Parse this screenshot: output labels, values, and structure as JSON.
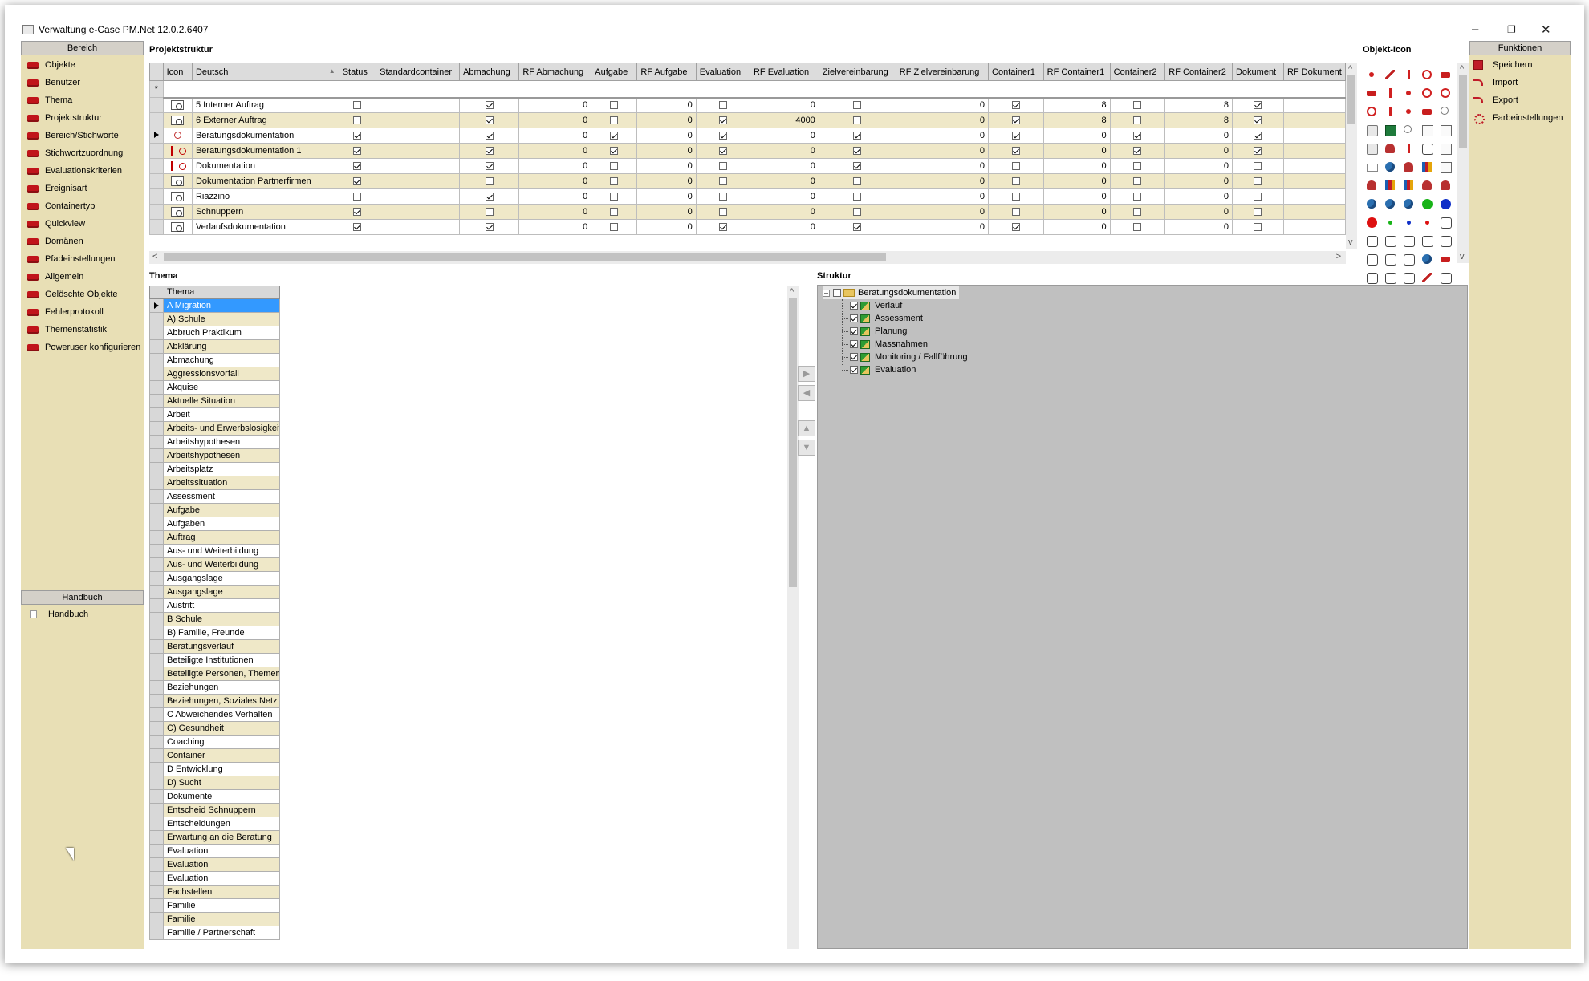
{
  "window": {
    "title": "Verwaltung e-Case PM.Net 12.0.2.6407",
    "minimize": "–",
    "restore": "❐",
    "close": "✕"
  },
  "bereich": {
    "header": "Bereich",
    "items": [
      "Objekte",
      "Benutzer",
      "Thema",
      "Projektstruktur",
      "Bereich/Stichworte",
      "Stichwortzuordnung",
      "Evaluationskriterien",
      "Ereignisart",
      "Containertyp",
      "Quickview",
      "Domänen",
      "Pfadeinstellungen",
      "Allgemein",
      "Gelöschte Objekte",
      "Fehlerprotokoll",
      "Themenstatistik",
      "Poweruser konfigurieren"
    ]
  },
  "handbuch": {
    "header": "Handbuch",
    "items": [
      "Handbuch"
    ]
  },
  "projektstruktur": {
    "title": "Projektstruktur",
    "new_row_marker": "*",
    "columns": [
      "Icon",
      "Deutsch",
      "Status",
      "Standardcontainer",
      "Abmachung",
      "RF Abmachung",
      "Aufgabe",
      "RF Aufgabe",
      "Evaluation",
      "RF Evaluation",
      "Zielvereinbarung",
      "RF Zielvereinbarung",
      "Container1",
      "RF Container1",
      "Container2",
      "RF Container2",
      "Dokument",
      "RF Dokument"
    ],
    "rows": [
      {
        "icon": "document-icon",
        "name": "5 Interner Auftrag",
        "status": false,
        "abm": true,
        "rf_abm": "0",
        "auf": false,
        "rf_auf": "0",
        "eval": false,
        "rf_eval": "0",
        "ziel": false,
        "rf_ziel": "0",
        "c1": true,
        "rf_c1": "8",
        "c2": false,
        "rf_c2": "8",
        "dok": true
      },
      {
        "icon": "document-icon",
        "name": "6 Externer Auftrag",
        "status": false,
        "abm": true,
        "rf_abm": "0",
        "auf": false,
        "rf_auf": "0",
        "eval": true,
        "rf_eval": "4000",
        "ziel": false,
        "rf_ziel": "0",
        "c1": true,
        "rf_c1": "8",
        "c2": false,
        "rf_c2": "8",
        "dok": true
      },
      {
        "icon": "magnifier-icon",
        "name": "Beratungsdokumentation",
        "status": true,
        "abm": true,
        "rf_abm": "0",
        "auf": true,
        "rf_auf": "0",
        "eval": true,
        "rf_eval": "0",
        "ziel": true,
        "rf_ziel": "0",
        "c1": true,
        "rf_c1": "0",
        "c2": true,
        "rf_c2": "0",
        "dok": true
      },
      {
        "icon": "red-ring-icon",
        "name": "Beratungsdokumentation 1",
        "status": true,
        "abm": true,
        "rf_abm": "0",
        "auf": true,
        "rf_auf": "0",
        "eval": true,
        "rf_eval": "0",
        "ziel": true,
        "rf_ziel": "0",
        "c1": true,
        "rf_c1": "0",
        "c2": true,
        "rf_c2": "0",
        "dok": true
      },
      {
        "icon": "red-ring-icon",
        "name": "Dokumentation",
        "status": true,
        "abm": true,
        "rf_abm": "0",
        "auf": false,
        "rf_auf": "0",
        "eval": false,
        "rf_eval": "0",
        "ziel": true,
        "rf_ziel": "0",
        "c1": false,
        "rf_c1": "0",
        "c2": false,
        "rf_c2": "0",
        "dok": false
      },
      {
        "icon": "document-icon",
        "name": "Dokumentation Partnerfirmen",
        "status": true,
        "abm": false,
        "rf_abm": "0",
        "auf": false,
        "rf_auf": "0",
        "eval": false,
        "rf_eval": "0",
        "ziel": false,
        "rf_ziel": "0",
        "c1": false,
        "rf_c1": "0",
        "c2": false,
        "rf_c2": "0",
        "dok": false
      },
      {
        "icon": "document-icon",
        "name": "Riazzino",
        "status": false,
        "abm": true,
        "rf_abm": "0",
        "auf": false,
        "rf_auf": "0",
        "eval": false,
        "rf_eval": "0",
        "ziel": false,
        "rf_ziel": "0",
        "c1": false,
        "rf_c1": "0",
        "c2": false,
        "rf_c2": "0",
        "dok": false
      },
      {
        "icon": "document-icon",
        "name": "Schnuppern",
        "status": true,
        "abm": false,
        "rf_abm": "0",
        "auf": false,
        "rf_auf": "0",
        "eval": false,
        "rf_eval": "0",
        "ziel": false,
        "rf_ziel": "0",
        "c1": false,
        "rf_c1": "0",
        "c2": false,
        "rf_c2": "0",
        "dok": false
      },
      {
        "icon": "document-icon",
        "name": "Verlaufsdokumentation",
        "status": true,
        "abm": true,
        "rf_abm": "0",
        "auf": false,
        "rf_auf": "0",
        "eval": true,
        "rf_eval": "0",
        "ziel": true,
        "rf_ziel": "0",
        "c1": true,
        "rf_c1": "0",
        "c2": false,
        "rf_c2": "0",
        "dok": false
      }
    ]
  },
  "objekt_icon": {
    "title": "Objekt-Icon",
    "icons": [
      "fork-icon",
      "pencil-icon",
      "trash-icon",
      "ring-icon",
      "bar-icon",
      "folder-icon",
      "pin-icon",
      "network-icon",
      "ring-icon",
      "bell-icon",
      "spinner-icon",
      "pin-icon",
      "eraser-icon",
      "lips-icon",
      "magnifier-icon",
      "lock-icon",
      "excel-icon",
      "magnifier-icon",
      "document-icon",
      "chart-icon",
      "cup-icon",
      "person-icon",
      "pin-icon",
      "mirror-icon",
      "calendar-icon",
      "envelope-icon",
      "globe-icon",
      "person-icon",
      "group-icon",
      "certificate-icon",
      "person-icon",
      "group-icon",
      "group-icon",
      "person-icon",
      "chat-icon",
      "globe-icon",
      "globe-icon",
      "globe-icon",
      "green-ball-icon",
      "blue-ball-icon",
      "red-ball-icon",
      "green-dot-icon",
      "blue-dot-icon",
      "red-dot-icon",
      "checklist-icon",
      "toolbox-icon",
      "archive-icon",
      "hand-icon",
      "handshake-icon",
      "cloud-icon",
      "coins-icon",
      "shield-icon",
      "box-icon",
      "globe-icon",
      "folder-icon",
      "edit-icon",
      "grid-icon",
      "cards-icon",
      "pen-icon",
      "tools-icon"
    ]
  },
  "funktionen": {
    "header": "Funktionen",
    "items": [
      "Speichern",
      "Import",
      "Export",
      "Farbeinstellungen"
    ]
  },
  "thema": {
    "title": "Thema",
    "column": "Thema",
    "rows": [
      "A Migration",
      "A) Schule",
      "Abbruch Praktikum",
      "Abklärung",
      "Abmachung",
      "Aggressionsvorfall",
      "Akquise",
      "Aktuelle Situation",
      "Arbeit",
      "Arbeits- und Erwerbslosigkeit",
      "Arbeitshypothesen",
      "Arbeitshypothesen",
      "Arbeitsplatz",
      "Arbeitssituation",
      "Assessment",
      "Aufgabe",
      "Aufgaben",
      "Auftrag",
      "Aus- und Weiterbildung",
      "Aus- und Weiterbildung",
      "Ausgangslage",
      "Ausgangslage",
      "Austritt",
      "B Schule",
      "B) Familie, Freunde",
      "Beratungsverlauf",
      "Beteiligte Institutionen",
      "Beteiligte Personen, Themen",
      "Beziehungen",
      "Beziehungen, Soziales Netz",
      "C Abweichendes Verhalten",
      "C) Gesundheit",
      "Coaching",
      "Container",
      "D Entwicklung",
      "D) Sucht",
      "Dokumente",
      "Entscheid Schnuppern",
      "Entscheidungen",
      "Erwartung an die Beratung",
      "Evaluation",
      "Evaluation",
      "Evaluation",
      "Fachstellen",
      "Familie",
      "Familie",
      "Familie / Partnerschaft"
    ]
  },
  "struktur": {
    "title": "Struktur",
    "root": {
      "label": "Beratungsdokumentation",
      "expander": "–"
    },
    "children": [
      "Verlauf",
      "Assessment",
      "Planung",
      "Massnahmen",
      "Monitoring / Fallführung",
      "Evaluation"
    ],
    "move_buttons": [
      "▶",
      "◀",
      "▲",
      "▼"
    ]
  },
  "scroll": {
    "left": "<",
    "right": ">",
    "up": "^",
    "down": "v"
  }
}
